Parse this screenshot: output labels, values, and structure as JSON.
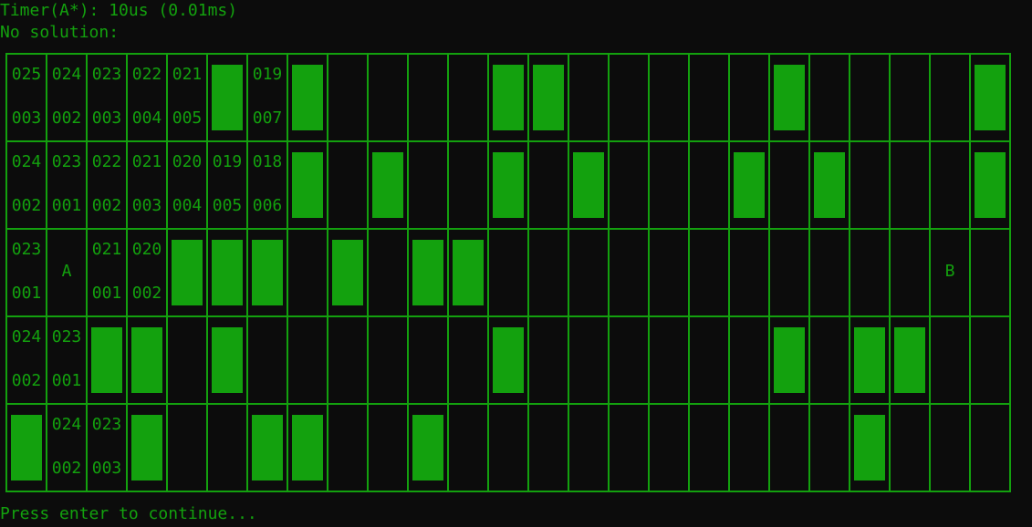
{
  "console": {
    "timer_line": "Timer(A*): 10us (0.01ms)",
    "status_line": "No solution:",
    "prompt_line": "Press enter to continue..."
  },
  "grid": {
    "rows": 5,
    "cols": 25,
    "walls": [
      [
        5,
        7,
        12,
        13,
        19,
        24
      ],
      [
        7,
        9,
        12,
        14,
        18,
        20,
        24
      ],
      [
        4,
        5,
        6,
        8,
        10,
        11
      ],
      [
        2,
        3,
        5,
        12,
        19,
        21,
        22
      ],
      [
        0,
        3,
        6,
        7,
        10,
        21
      ]
    ],
    "labels": [
      {
        "row": 0,
        "col": 0,
        "top": "025",
        "bottom": "003"
      },
      {
        "row": 0,
        "col": 1,
        "top": "024",
        "bottom": "002"
      },
      {
        "row": 0,
        "col": 2,
        "top": "023",
        "bottom": "003"
      },
      {
        "row": 0,
        "col": 3,
        "top": "022",
        "bottom": "004"
      },
      {
        "row": 0,
        "col": 4,
        "top": "021",
        "bottom": "005"
      },
      {
        "row": 0,
        "col": 6,
        "top": "019",
        "bottom": "007"
      },
      {
        "row": 1,
        "col": 0,
        "top": "024",
        "bottom": "002"
      },
      {
        "row": 1,
        "col": 1,
        "top": "023",
        "bottom": "001"
      },
      {
        "row": 1,
        "col": 2,
        "top": "022",
        "bottom": "002"
      },
      {
        "row": 1,
        "col": 3,
        "top": "021",
        "bottom": "003"
      },
      {
        "row": 1,
        "col": 4,
        "top": "020",
        "bottom": "004"
      },
      {
        "row": 1,
        "col": 5,
        "top": "019",
        "bottom": "005"
      },
      {
        "row": 1,
        "col": 6,
        "top": "018",
        "bottom": "006"
      },
      {
        "row": 2,
        "col": 0,
        "top": "023",
        "bottom": "001"
      },
      {
        "row": 2,
        "col": 1,
        "center": "A"
      },
      {
        "row": 2,
        "col": 2,
        "top": "021",
        "bottom": "001"
      },
      {
        "row": 2,
        "col": 3,
        "top": "020",
        "bottom": "002"
      },
      {
        "row": 2,
        "col": 23,
        "center": "B"
      },
      {
        "row": 3,
        "col": 0,
        "top": "024",
        "bottom": "002"
      },
      {
        "row": 3,
        "col": 1,
        "top": "023",
        "bottom": "001"
      },
      {
        "row": 4,
        "col": 1,
        "top": "024",
        "bottom": "002"
      },
      {
        "row": 4,
        "col": 2,
        "top": "023",
        "bottom": "003"
      }
    ]
  }
}
